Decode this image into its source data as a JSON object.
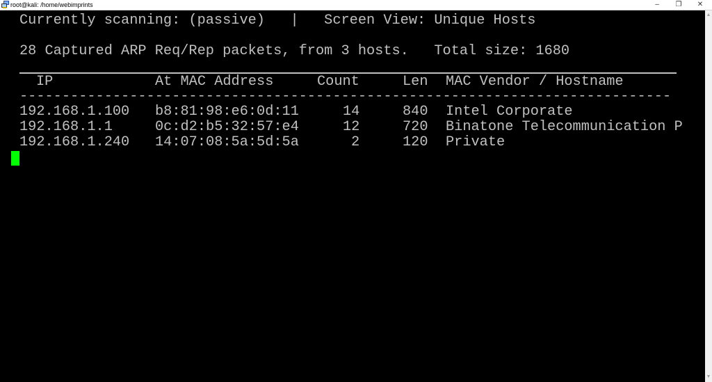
{
  "window": {
    "title": "root@kali: /home/webimprints",
    "minimize_label": "–",
    "maximize_label": "❐",
    "close_label": "✕",
    "icon": "putty-terminal-icon"
  },
  "terminal": {
    "status_line": "Currently scanning: (passive)   |   Screen View: Unique Hosts",
    "summary_line": "28 Captured ARP Req/Rep packets, from 3 hosts.   Total size: 1680",
    "headers": {
      "ip": "IP",
      "mac": "At MAC Address",
      "count": "Count",
      "len": "Len",
      "vendor": "MAC Vendor / Hostname"
    },
    "separator": "-----------------------------------------------------------------------------",
    "rows": [
      {
        "ip": "192.168.1.100",
        "mac": "b8:81:98:e6:0d:11",
        "count": "14",
        "len": "840",
        "vendor": "Intel Corporate"
      },
      {
        "ip": "192.168.1.1",
        "mac": "0c:d2:b5:32:57:e4",
        "count": "12",
        "len": "720",
        "vendor": "Binatone Telecommunication P"
      },
      {
        "ip": "192.168.1.240",
        "mac": "14:07:08:5a:5d:5a",
        "count": "2",
        "len": "120",
        "vendor": "Private"
      }
    ],
    "cursor_color": "#00ff00",
    "text_color": "#c0c0c0",
    "background_color": "#000000"
  },
  "scrollbar": {
    "up_arrow": "▲",
    "down_arrow": "▼"
  }
}
